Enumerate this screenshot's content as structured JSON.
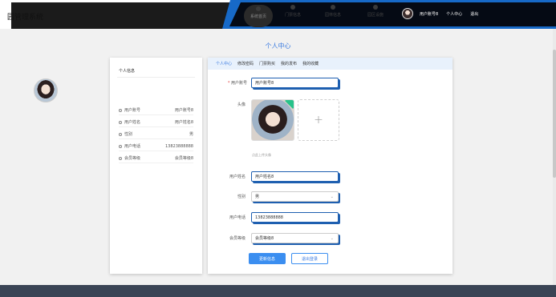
{
  "header": {
    "site_title": "园管理系统",
    "nav": [
      {
        "label": "系统首页",
        "active": true
      },
      {
        "label": "门票信息",
        "active": false
      },
      {
        "label": "园林信息",
        "active": false
      },
      {
        "label": "园区设施",
        "active": false
      }
    ],
    "username": "用户账号8",
    "profile_link": "个人中心",
    "logout_link": "退出"
  },
  "page_title": "个人中心",
  "side": {
    "title": "个人信息",
    "rows": [
      {
        "key": "用户账号",
        "value": "用户账号8"
      },
      {
        "key": "用户姓名",
        "value": "用户姓名8"
      },
      {
        "key": "性别",
        "value": "男"
      },
      {
        "key": "用户电话",
        "value": "13823888888"
      },
      {
        "key": "会员等级",
        "value": "会员等级8"
      }
    ]
  },
  "tabs": [
    "个人中心",
    "修改密码",
    "门票购买",
    "我的发布",
    "我的收藏"
  ],
  "form": {
    "account_label": "用户账号",
    "account_value": "用户账号8",
    "avatar_label": "头像",
    "avatar_hint": "点此上传头像",
    "name_label": "用户姓名",
    "name_value": "用户姓名8",
    "gender_label": "性别",
    "gender_value": "男",
    "phone_label": "用户电话",
    "phone_value": "13823888888",
    "level_label": "会员等级",
    "level_value": "会员等级8",
    "update_button": "更新信息",
    "logout_button": "退出登录"
  },
  "colors": {
    "accent": "#3b8ef0",
    "header_blue": "#1769c7",
    "footer": "#3a4455"
  }
}
